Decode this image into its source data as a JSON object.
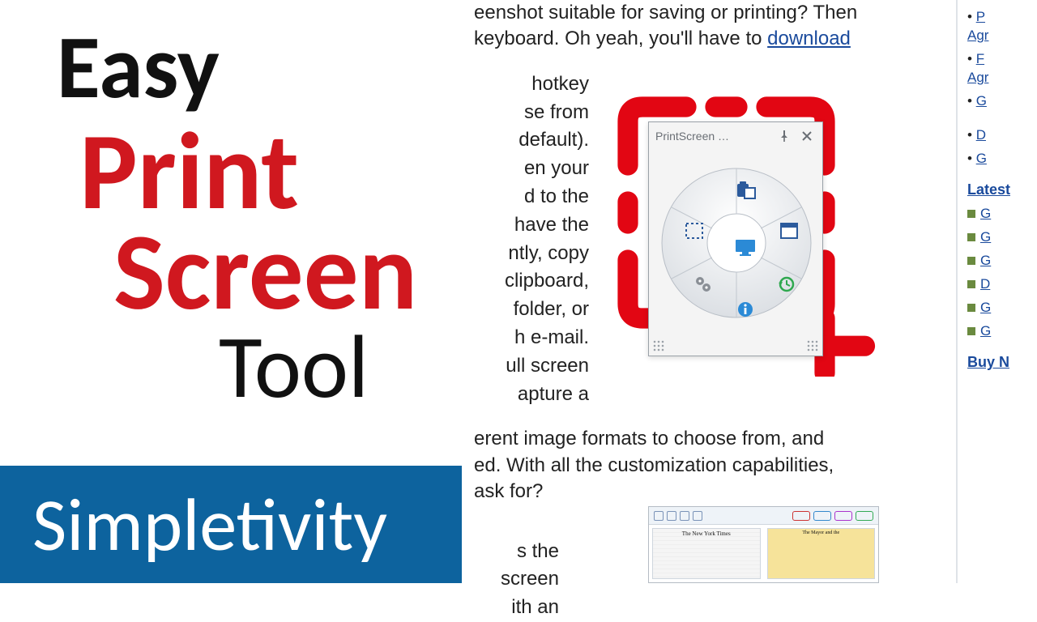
{
  "title": {
    "line1": "Easy",
    "line2": "Print",
    "line3": "Screen",
    "line4": "Tool"
  },
  "badge": {
    "label": "Simpletivity"
  },
  "article": {
    "p1_a": "eenshot suitable for saving or printing? Then",
    "p1_b": " keyboard. Oh yeah, you'll have to ",
    "p1_link": "download",
    "frag": [
      "hotkey",
      "se from",
      "default).",
      "en your",
      "d to the",
      "have the",
      "ntly, copy",
      "clipboard,",
      "folder, or",
      "h e-mail.",
      "ull screen",
      "apture a"
    ],
    "p3": "erent image formats to choose from, and",
    "p3b": "ed. With all the customization capabilities,",
    "p3c": "ask for?",
    "p4": [
      "s the",
      "screen",
      "ith an"
    ]
  },
  "widget": {
    "title": "PrintScreen …",
    "icons": {
      "top": "paste-icon",
      "left": "region-icon",
      "right": "window-icon",
      "center": "monitor-icon",
      "bl": "settings-icon",
      "br": "history-icon",
      "bottom": "info-icon"
    }
  },
  "sidebar": {
    "top_items": [
      {
        "t": "P",
        "sub": "Agr"
      },
      {
        "t": "F",
        "sub": "Agr"
      },
      {
        "t": "G"
      },
      {
        "t": "D"
      },
      {
        "t": "G"
      }
    ],
    "heading1": "Latest",
    "sq_items": [
      "G",
      "G",
      "G",
      "D",
      "G",
      "G"
    ],
    "heading2": "Buy N"
  },
  "thumb": {
    "left_title": "The New York Times",
    "right_title": "The Mayor and the"
  }
}
